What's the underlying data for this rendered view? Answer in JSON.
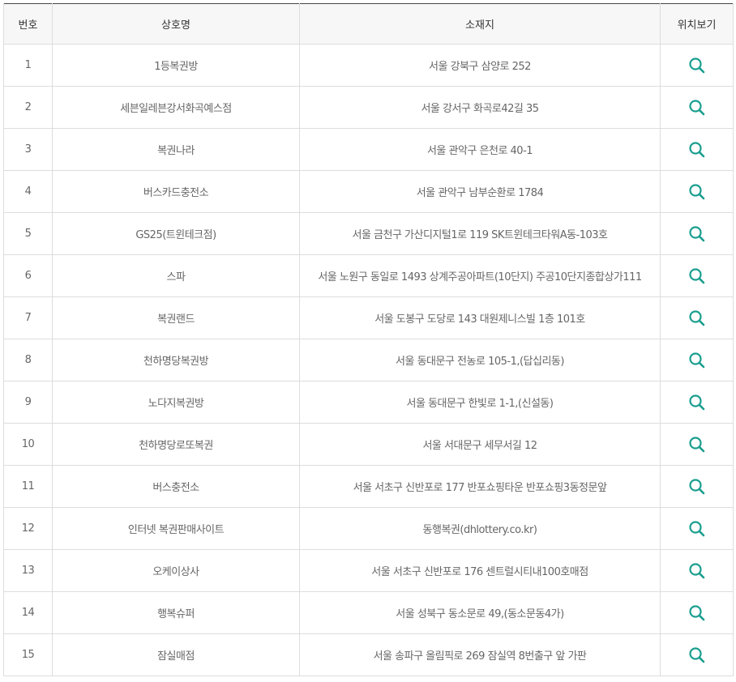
{
  "table": {
    "headers": {
      "no": "번호",
      "name": "상호명",
      "address": "소재지",
      "map": "위치보기"
    },
    "rows": [
      {
        "no": "1",
        "name": "1등복권방",
        "address": "서울 강북구 삼양로 252"
      },
      {
        "no": "2",
        "name": "세븐일레븐강서화곡예스점",
        "address": "서울 강서구 화곡로42길 35"
      },
      {
        "no": "3",
        "name": "복권나라",
        "address": "서울 관악구 은천로 40-1"
      },
      {
        "no": "4",
        "name": "버스카드충전소",
        "address": "서울 관악구 남부순환로 1784"
      },
      {
        "no": "5",
        "name": "GS25(트윈테크점)",
        "address": "서울 금천구 가산디지털1로 119 SK트윈테크타워A동-103호"
      },
      {
        "no": "6",
        "name": "스파",
        "address": "서울 노원구 동일로 1493 상계주공아파트(10단지) 주공10단지종합상가111"
      },
      {
        "no": "7",
        "name": "복권랜드",
        "address": "서울 도봉구 도당로 143 대원제니스빌 1층 101호"
      },
      {
        "no": "8",
        "name": "천하명당복권방",
        "address": "서울 동대문구 전농로 105-1,(답십리동)"
      },
      {
        "no": "9",
        "name": "노다지복권방",
        "address": "서울 동대문구 한빛로 1-1,(신설동)"
      },
      {
        "no": "10",
        "name": "천하명당로또복권",
        "address": "서울 서대문구 세무서길 12"
      },
      {
        "no": "11",
        "name": "버스충전소",
        "address": "서울 서초구 신반포로 177 반포쇼핑타운 반포쇼핑3동정문앞"
      },
      {
        "no": "12",
        "name": "인터넷 복권판매사이트",
        "address": "동행복권(dhlottery.co.kr)"
      },
      {
        "no": "13",
        "name": "오케이상사",
        "address": "서울 서초구 신반포로 176 센트럴시티내100호매점"
      },
      {
        "no": "14",
        "name": "행복슈퍼",
        "address": "서울 성북구 동소문로 49,(동소문동4가)"
      },
      {
        "no": "15",
        "name": "잠실매점",
        "address": "서울 송파구 올림픽로 269 잠실역 8번출구 앞 가판"
      }
    ]
  },
  "icons": {
    "map_button": "search-icon"
  },
  "colors": {
    "accent": "#1a9e8f",
    "header_bg": "#f7f7f7",
    "border": "#dddddd",
    "top_border": "#444444"
  }
}
